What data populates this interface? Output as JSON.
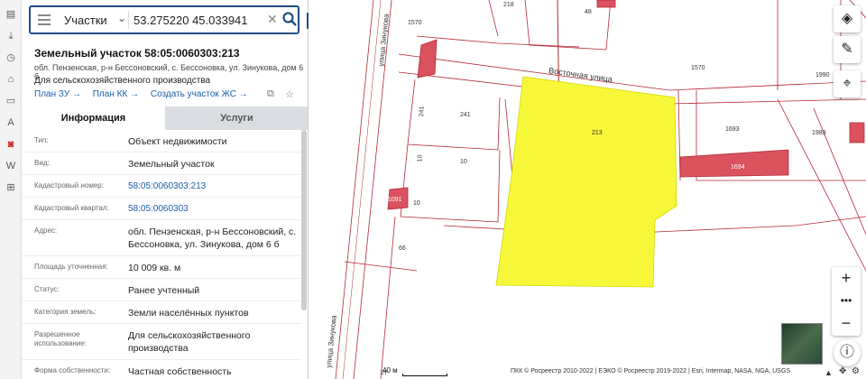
{
  "search": {
    "type_label": "Участки",
    "query": "53.275220 45.033941"
  },
  "parcel": {
    "title": "Земельный участок 58:05:0060303:213",
    "address_short": "обл. Пензенская, р-н Бессоновский, с. Бессоновка, ул. Зинукова, дом 6 б",
    "purpose": "Для сельскохозяйственного производства",
    "links": [
      "План ЗУ →",
      "План КК →",
      "Создать участок ЖС →"
    ]
  },
  "tabs": {
    "info": "Информация",
    "services": "Услуги"
  },
  "rows": [
    {
      "label": "Тип:",
      "value": "Объект недвижимости"
    },
    {
      "label": "Вид:",
      "value": "Земельный участок"
    },
    {
      "label": "Кадастровый номер:",
      "value": "58:05:0060303:213"
    },
    {
      "label": "Кадастровый квартал:",
      "value": "58:05:0060303"
    },
    {
      "label": "Адрес:",
      "value": "обл. Пензенская, р-н Бессоновский, с. Бессоновка, ул. Зинукова, дом 6 б"
    },
    {
      "label": "Площадь уточненная:",
      "value": "10 009 кв. м"
    },
    {
      "label": "Статус:",
      "value": "Ранее учтенный"
    },
    {
      "label": "Категория земель:",
      "value": "Земли населённых пунктов"
    },
    {
      "label": "Разрешенное использование:",
      "value": "Для сельскохозяйственного производства"
    },
    {
      "label": "Форма собственности:",
      "value": "Частная собственность"
    }
  ],
  "map": {
    "street_east": "Восточная улица",
    "street_zinukova_top": "улица Зинукова",
    "street_zinukova_bottom": "улица Зинукова",
    "labels": {
      "p218": "218",
      "p48": "48",
      "p1570a": "1570",
      "p1570b": "1570",
      "p1990": "1990",
      "p241a": "241",
      "p241b": "241",
      "p213": "213",
      "p1693": "1693",
      "p1989": "1989",
      "p10a": "10",
      "p10b": "10",
      "p10c": "10",
      "p66": "66",
      "p27": "27",
      "b1694": "1694",
      "b1691": "1091"
    },
    "scale": "40 м",
    "credit": "ПКК © Росреестр 2010-2022 | ЕЭКО © Росреестр 2019-2022 | Esri, Intermap, NASA, NGA, USGS",
    "colors": {
      "selected_parcel": "#f7f73a",
      "building": "#d9525e",
      "boundary": "#b42836"
    }
  }
}
